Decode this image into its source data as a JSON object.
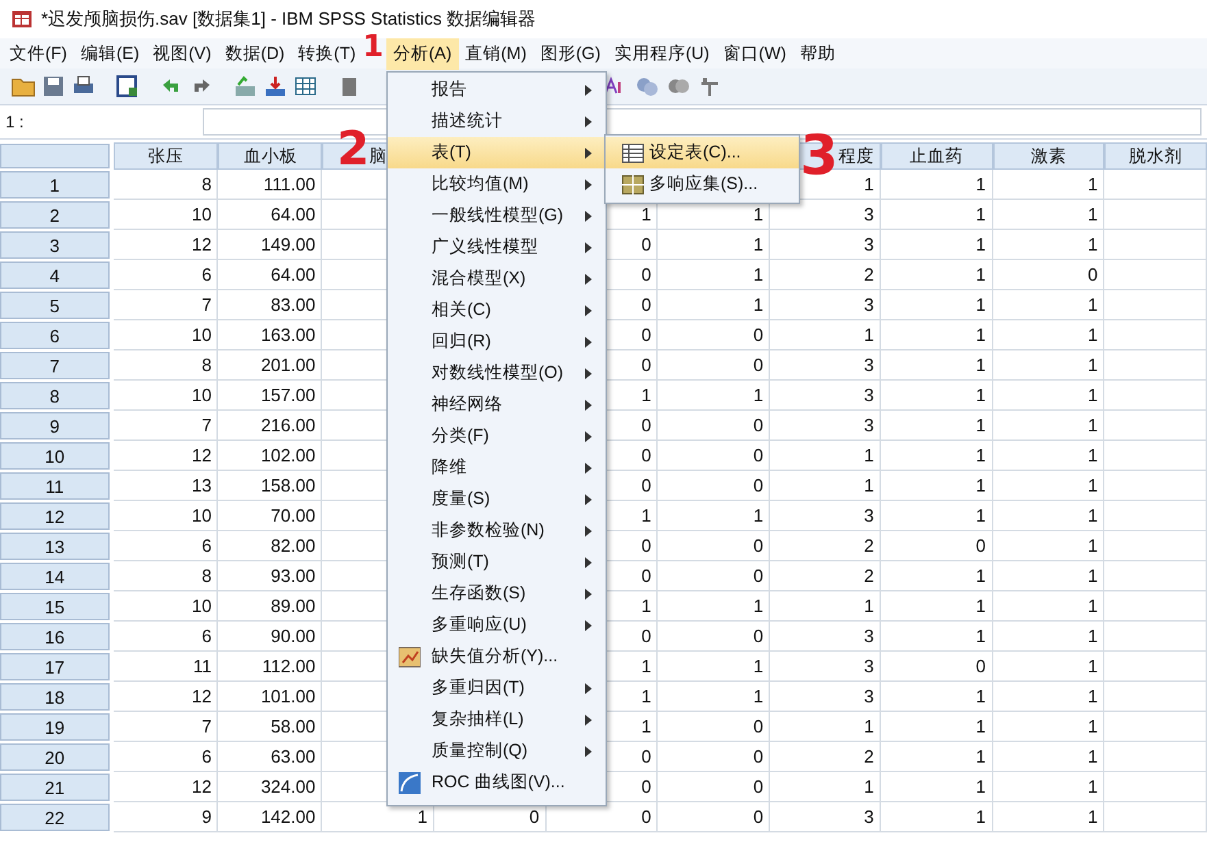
{
  "window": {
    "title": "*迟发颅脑损伤.sav [数据集1] - IBM SPSS Statistics 数据编辑器"
  },
  "menu_bar": [
    {
      "label": "文件(F)",
      "selected": false
    },
    {
      "label": "编辑(E)",
      "selected": false
    },
    {
      "label": "视图(V)",
      "selected": false
    },
    {
      "label": "数据(D)",
      "selected": false
    },
    {
      "label": "转换(T)",
      "selected": false
    },
    {
      "label": "分析(A)",
      "selected": true
    },
    {
      "label": "直销(M)",
      "selected": false
    },
    {
      "label": "图形(G)",
      "selected": false
    },
    {
      "label": "实用程序(U)",
      "selected": false
    },
    {
      "label": "窗口(W)",
      "selected": false
    },
    {
      "label": "帮助",
      "selected": false
    }
  ],
  "cell_editor": {
    "label": "1 :"
  },
  "table": {
    "columns": [
      "张压",
      "血小板",
      "脑",
      null,
      null,
      null,
      "程度",
      "止血药",
      "激素",
      "脱水剂"
    ],
    "rows": [
      {
        "case": "1",
        "cells": [
          "8",
          "111.00",
          null,
          null,
          null,
          null,
          "1",
          "1",
          "1",
          null
        ]
      },
      {
        "case": "2",
        "cells": [
          "10",
          "64.00",
          null,
          null,
          "1",
          "1",
          "3",
          "1",
          "1",
          null
        ]
      },
      {
        "case": "3",
        "cells": [
          "12",
          "149.00",
          null,
          null,
          "0",
          "1",
          "3",
          "1",
          "1",
          null
        ]
      },
      {
        "case": "4",
        "cells": [
          "6",
          "64.00",
          null,
          null,
          "0",
          "1",
          "2",
          "1",
          "0",
          null
        ]
      },
      {
        "case": "5",
        "cells": [
          "7",
          "83.00",
          null,
          null,
          "0",
          "1",
          "3",
          "1",
          "1",
          null
        ]
      },
      {
        "case": "6",
        "cells": [
          "10",
          "163.00",
          null,
          null,
          "0",
          "0",
          "1",
          "1",
          "1",
          null
        ]
      },
      {
        "case": "7",
        "cells": [
          "8",
          "201.00",
          null,
          null,
          "0",
          "0",
          "3",
          "1",
          "1",
          null
        ]
      },
      {
        "case": "8",
        "cells": [
          "10",
          "157.00",
          null,
          null,
          "1",
          "1",
          "3",
          "1",
          "1",
          null
        ]
      },
      {
        "case": "9",
        "cells": [
          "7",
          "216.00",
          null,
          null,
          "0",
          "0",
          "3",
          "1",
          "1",
          null
        ]
      },
      {
        "case": "10",
        "cells": [
          "12",
          "102.00",
          null,
          null,
          "0",
          "0",
          "1",
          "1",
          "1",
          null
        ]
      },
      {
        "case": "11",
        "cells": [
          "13",
          "158.00",
          null,
          null,
          "0",
          "0",
          "1",
          "1",
          "1",
          null
        ]
      },
      {
        "case": "12",
        "cells": [
          "10",
          "70.00",
          null,
          null,
          "1",
          "1",
          "3",
          "1",
          "1",
          null
        ]
      },
      {
        "case": "13",
        "cells": [
          "6",
          "82.00",
          null,
          null,
          "0",
          "0",
          "2",
          "0",
          "1",
          null
        ]
      },
      {
        "case": "14",
        "cells": [
          "8",
          "93.00",
          null,
          null,
          "0",
          "0",
          "2",
          "1",
          "1",
          null
        ]
      },
      {
        "case": "15",
        "cells": [
          "10",
          "89.00",
          null,
          null,
          "1",
          "1",
          "1",
          "1",
          "1",
          null
        ]
      },
      {
        "case": "16",
        "cells": [
          "6",
          "90.00",
          null,
          null,
          "0",
          "0",
          "3",
          "1",
          "1",
          null
        ]
      },
      {
        "case": "17",
        "cells": [
          "11",
          "112.00",
          null,
          null,
          "1",
          "1",
          "3",
          "0",
          "1",
          null
        ]
      },
      {
        "case": "18",
        "cells": [
          "12",
          "101.00",
          null,
          null,
          "1",
          "1",
          "3",
          "1",
          "1",
          null
        ]
      },
      {
        "case": "19",
        "cells": [
          "7",
          "58.00",
          null,
          null,
          "1",
          "0",
          "1",
          "1",
          "1",
          null
        ]
      },
      {
        "case": "20",
        "cells": [
          "6",
          "63.00",
          null,
          null,
          "0",
          "0",
          "2",
          "1",
          "1",
          null
        ]
      },
      {
        "case": "21",
        "cells": [
          "12",
          "324.00",
          null,
          null,
          "0",
          "0",
          "1",
          "1",
          "1",
          null
        ]
      },
      {
        "case": "22",
        "cells": [
          "9",
          "142.00",
          "1",
          "0",
          "0",
          "0",
          "3",
          "1",
          "1",
          null
        ]
      }
    ]
  },
  "analyze_menu": {
    "items": [
      {
        "label": "报告",
        "kind": "submenu",
        "selected": false
      },
      {
        "label": "描述统计",
        "kind": "submenu",
        "selected": false
      },
      {
        "label": "表(T)",
        "kind": "submenu",
        "selected": true
      },
      {
        "label": "比较均值(M)",
        "kind": "submenu",
        "selected": false
      },
      {
        "label": "一般线性模型(G)",
        "kind": "submenu",
        "selected": false
      },
      {
        "label": "广义线性模型",
        "kind": "submenu",
        "selected": false
      },
      {
        "label": "混合模型(X)",
        "kind": "submenu",
        "selected": false
      },
      {
        "label": "相关(C)",
        "kind": "submenu",
        "selected": false
      },
      {
        "label": "回归(R)",
        "kind": "submenu",
        "selected": false
      },
      {
        "label": "对数线性模型(O)",
        "kind": "submenu",
        "selected": false
      },
      {
        "label": "神经网络",
        "kind": "submenu",
        "selected": false
      },
      {
        "label": "分类(F)",
        "kind": "submenu",
        "selected": false
      },
      {
        "label": "降维",
        "kind": "submenu",
        "selected": false
      },
      {
        "label": "度量(S)",
        "kind": "submenu",
        "selected": false
      },
      {
        "label": "非参数检验(N)",
        "kind": "submenu",
        "selected": false
      },
      {
        "label": "预测(T)",
        "kind": "submenu",
        "selected": false
      },
      {
        "label": "生存函数(S)",
        "kind": "submenu",
        "selected": false
      },
      {
        "label": "多重响应(U)",
        "kind": "submenu",
        "selected": false
      },
      {
        "label": "缺失值分析(Y)...",
        "kind": "missing",
        "selected": false
      },
      {
        "label": "多重归因(T)",
        "kind": "submenu",
        "selected": false
      },
      {
        "label": "复杂抽样(L)",
        "kind": "submenu",
        "selected": false
      },
      {
        "label": "质量控制(Q)",
        "kind": "submenu",
        "selected": false
      },
      {
        "label": "ROC 曲线图(V)...",
        "kind": "roc",
        "selected": false
      }
    ]
  },
  "tables_submenu": {
    "items": [
      {
        "label": "设定表(C)...",
        "kind": "table",
        "selected": true
      },
      {
        "label": "多响应集(S)...",
        "kind": "sets",
        "selected": false
      }
    ]
  },
  "annotations": [
    "1",
    "2",
    "3"
  ]
}
